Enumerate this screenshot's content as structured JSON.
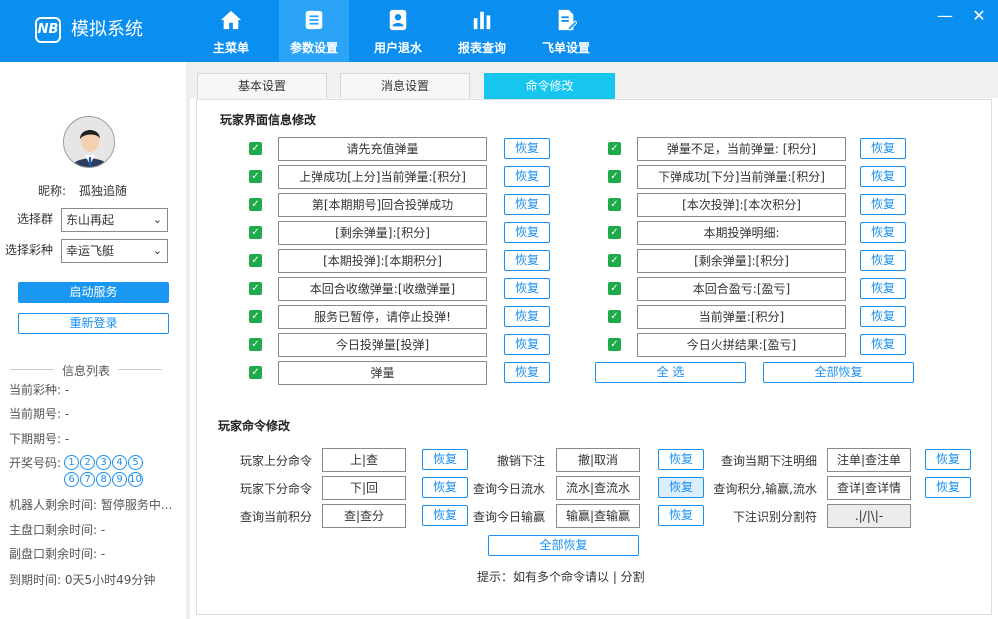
{
  "app": {
    "logo": "NB",
    "title": "模拟系统"
  },
  "nav": [
    {
      "label": "主菜单",
      "icon": "home-icon"
    },
    {
      "label": "参数设置",
      "icon": "list-icon"
    },
    {
      "label": "用户退水",
      "icon": "user-card-icon"
    },
    {
      "label": "报表查询",
      "icon": "bar-chart-icon"
    },
    {
      "label": "飞单设置",
      "icon": "edit-doc-icon"
    }
  ],
  "window": {
    "minimize": "—",
    "close": "✕"
  },
  "left": {
    "nickname_label": "昵称:",
    "nickname": "孤独追随",
    "group_label": "选择群",
    "group_value": "东山再起",
    "lottery_label": "选择彩种",
    "lottery_value": "幸运飞艇",
    "start_btn": "启动服务",
    "relogin_btn": "重新登录",
    "info_title": "信息列表",
    "info": {
      "current_lottery": "当前彩种:  -",
      "current_period": "当前期号:  -",
      "next_period": "下期期号:  -",
      "draw_label": "开奖号码:",
      "draw_numbers": [
        "1",
        "2",
        "3",
        "4",
        "5",
        "6",
        "7",
        "8",
        "9",
        "10"
      ],
      "robot_remain": "机器人剩余时间:   暂停服务中...",
      "main_remain": "主盘口剩余时间:   -",
      "sub_remain": "副盘口剩余时间:   -",
      "expire": "到期时间:   0天5小时49分钟"
    }
  },
  "tabs": [
    "基本设置",
    "消息设置",
    "命令修改"
  ],
  "player_ui": {
    "title": "玩家界面信息修改",
    "left": [
      "请先充值弹量",
      "上弹成功[上分]当前弹量:[积分]",
      "第[本期期号]回合投弹成功",
      "[剩余弹量]:[积分]",
      "[本期投弹]:[本期积分]",
      "本回合收缴弹量:[收缴弹量]",
      "服务已暂停，请停止投弹!",
      "今日投弹量[投弹]",
      "弹量"
    ],
    "right": [
      "弹量不足，当前弹量: [积分]",
      "下弹成功[下分]当前弹量:[积分]",
      "[本次投弹]:[本次积分]",
      "本期投弹明细:",
      "[剩余弹量]:[积分]",
      "本回合盈亏:[盈亏]",
      "当前弹量:[积分]",
      "今日火拼结果:[盈亏]"
    ],
    "restore": "恢复",
    "select_all": "全    选",
    "restore_all": "全部恢复"
  },
  "commands": {
    "title": "玩家命令修改",
    "rows": [
      [
        {
          "label": "玩家上分命令",
          "value": "上|查"
        },
        {
          "label": "撤销下注",
          "value": "撤|取消"
        },
        {
          "label": "查询当期下注明细",
          "value": "注单|查注单"
        }
      ],
      [
        {
          "label": "玩家下分命令",
          "value": "下|回"
        },
        {
          "label": "查询今日流水",
          "value": "流水|查流水"
        },
        {
          "label": "查询积分,输赢,流水",
          "value": "查详|查详情"
        }
      ],
      [
        {
          "label": "查询当前积分",
          "value": "查|查分"
        },
        {
          "label": "查询今日输赢",
          "value": "输赢|查输赢"
        },
        {
          "label": "下注识别分割符",
          "value": ".|/|\\|-"
        }
      ]
    ],
    "restore": "恢复",
    "restore_all": "全部恢复",
    "hint": "提示：如有多个命令请以   |   分割"
  },
  "colors": {
    "header": "#0a8ff0",
    "active_tab": "#17c6ef",
    "checkbox": "#1faa4c",
    "accent": "#1a8ff0"
  }
}
